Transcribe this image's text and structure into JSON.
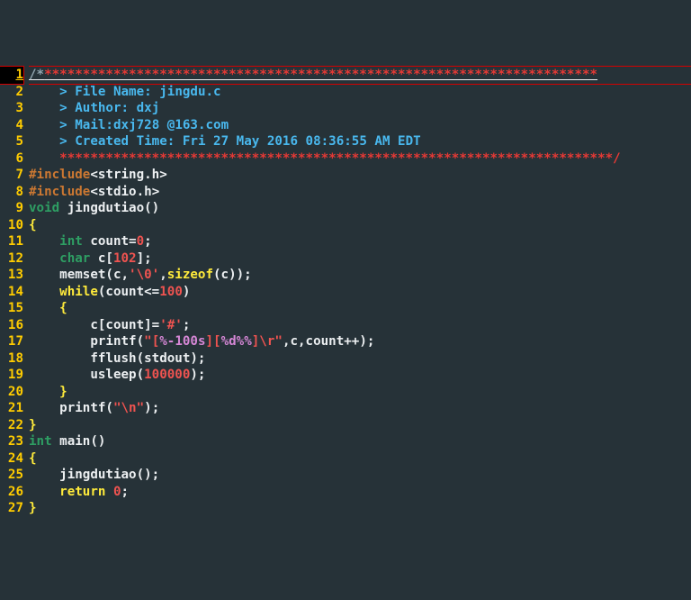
{
  "editor": {
    "lineNumbers": [
      "1",
      "2",
      "3",
      "4",
      "5",
      "6",
      "7",
      "8",
      "9",
      "10",
      "11",
      "12",
      "13",
      "14",
      "15",
      "16",
      "17",
      "18",
      "19",
      "20",
      "21",
      "22",
      "23",
      "24",
      "25",
      "26",
      "27"
    ],
    "header": {
      "slashStars": "/*",
      "starRow": "************************************************************************",
      "starRowEnd": "************************************************************************/",
      "space": "    ",
      "gt": "> ",
      "fileLabel": "File Name: ",
      "fileName": "jingdu.c",
      "authorLabel": "Author: ",
      "author": "dxj",
      "mailLabel": "Mail:",
      "mail": "dxj728 @163.com",
      "createdLabel": "Created Time: ",
      "created": "Fri 27 May 2016 08:36:55 AM EDT"
    },
    "code": {
      "include": "#include",
      "lt": "<",
      "gt": ">",
      "string_h": "string.h",
      "stdio_h": "stdio.h",
      "void": "void",
      "jingdutiao": " jingdutiao()",
      "lbrace": "{",
      "rbrace": "}",
      "indent1": "    ",
      "indent2": "        ",
      "int": "int",
      "count_decl": " count=",
      "zero": "0",
      "semi": ";",
      "char": "char",
      "c_decl": " c[",
      "sz102": "102",
      "rbrack_semi": "];",
      "memset_pre": "memset(c,",
      "nul_char": "'\\0'",
      "memset_post": ",",
      "sizeof": "sizeof",
      "memset_end": "(c));",
      "while": "while",
      "while_cond": "(count<=",
      "hundred": "100",
      "rparen": ")",
      "assign_c": "c[count]=",
      "hash_char": "'#'",
      "printf": "printf(",
      "dq": "\"",
      "lbrack": "[",
      "fmt100s": "%-100s",
      "rbrack": "]",
      "fmtd": "%d%%",
      "slash_r": "\\r",
      "printf_tail": ",c,count++);",
      "fflush": "fflush(stdout);",
      "usleep": "usleep(",
      "usleep_n": "100000",
      "usleep_end": ");",
      "slash_n": "\\n",
      "printf_n_tail": ");",
      "main": " main()",
      "call_jingdutiao": "jingdutiao();",
      "return": "return",
      "return_sp": " ",
      "return_z": "0"
    }
  }
}
